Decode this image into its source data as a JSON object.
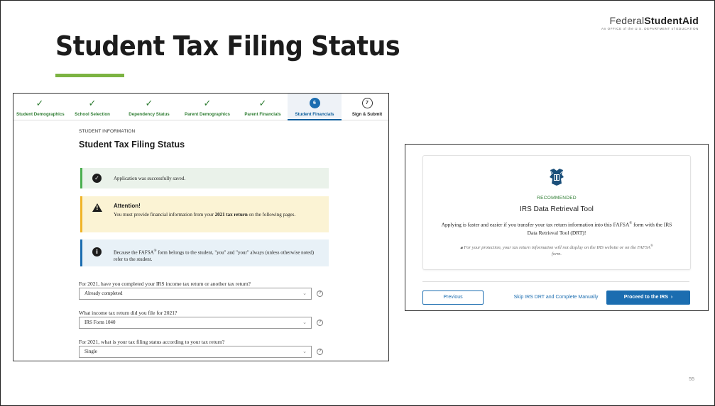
{
  "slide": {
    "title": "Student Tax Filing Status",
    "logo_text_light": "Federal",
    "logo_text_bold": "StudentAid",
    "logo_tagline": "An OFFICE of the U.S. DEPARTMENT of EDUCATION",
    "page_number": "55",
    "accent_color": "#7cb342"
  },
  "left": {
    "steps": [
      {
        "label": "Student Demographics",
        "state": "done",
        "marker": "✓"
      },
      {
        "label": "School Selection",
        "state": "done",
        "marker": "✓"
      },
      {
        "label": "Dependency Status",
        "state": "done",
        "marker": "✓"
      },
      {
        "label": "Parent Demographics",
        "state": "done",
        "marker": "✓"
      },
      {
        "label": "Parent Financials",
        "state": "done",
        "marker": "✓"
      },
      {
        "label": "Student Financials",
        "state": "active",
        "marker": "6"
      },
      {
        "label": "Sign & Submit",
        "state": "pending",
        "marker": "7"
      }
    ],
    "section_label": "STUDENT INFORMATION",
    "form_title": "Student Tax Filing Status",
    "success_text": "Application was successfully saved.",
    "warning_heading": "Attention!",
    "warning_text_pre": "You must provide financial information from your ",
    "warning_text_bold": "2021 tax return",
    "warning_text_post": " on the following pages.",
    "info_text_pre": "Because the FAFSA",
    "info_sup": "®",
    "info_text_post": " form belongs to the student, \"you\" and \"your\" always (unless otherwise noted) refer to the student.",
    "questions": [
      {
        "question": "For 2021, have you completed your IRS income tax return or another tax return?",
        "answer": "Already completed"
      },
      {
        "question": "What income tax return did you file for 2021?",
        "answer": "IRS Form 1040"
      },
      {
        "question": "For 2021, what is your tax filing status according to your tax return?",
        "answer": "Single"
      }
    ]
  },
  "right": {
    "recommended": "RECOMMENDED",
    "title": "IRS Data Retrieval Tool",
    "body_pre": "Applying is faster and easier if you transfer your tax return information into this FAFSA",
    "body_sup": "®",
    "body_post": " form with the IRS Data Retrieval Tool (DRT)!",
    "note_pre": "For your protection, your tax return information will not display on the IRS website or on the FAFSA",
    "note_sup": "®",
    "note_post": " form.",
    "previous_label": "Previous",
    "skip_label": "Skip IRS DRT and Complete Manually",
    "proceed_label": "Proceed to the IRS",
    "proceed_arrow": "›",
    "button_color": "#1b6db0"
  }
}
